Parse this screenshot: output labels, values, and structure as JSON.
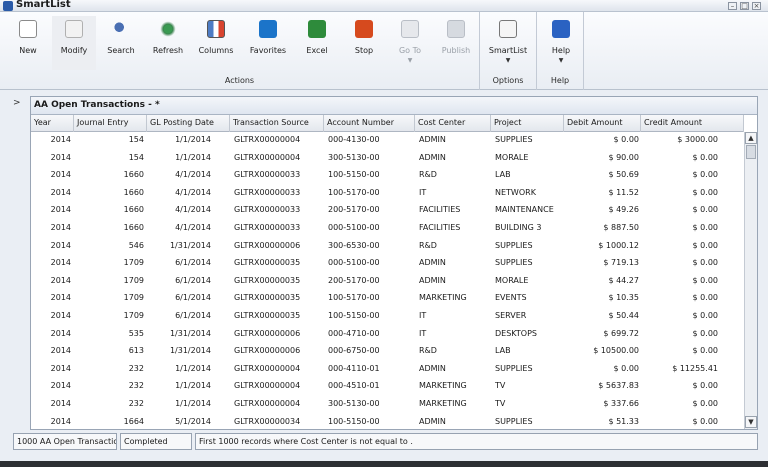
{
  "window": {
    "title": "SmartList"
  },
  "ribbon": {
    "buttons": {
      "new": "New",
      "modify": "Modify",
      "search": "Search",
      "refresh": "Refresh",
      "columns": "Columns",
      "favorites": "Favorites",
      "excel": "Excel",
      "stop": "Stop",
      "goto": "Go To",
      "publish": "Publish",
      "smartlist": "SmartList",
      "help": "Help"
    },
    "groups": {
      "actions": "Actions",
      "options": "Options",
      "help": "Help"
    }
  },
  "grid": {
    "title": "AA Open Transactions - *",
    "expander": ">",
    "columns": [
      "Year",
      "Journal Entry",
      "GL Posting Date",
      "Transaction Source",
      "Account Number",
      "Cost Center",
      "Project",
      "Debit Amount",
      "Credit Amount"
    ],
    "rows": [
      [
        "2014",
        "154",
        "1/1/2014",
        "GLTRX00000004",
        "000-4130-00",
        "ADMIN",
        "SUPPLIES",
        "$ 0.00",
        "$ 3000.00"
      ],
      [
        "2014",
        "154",
        "1/1/2014",
        "GLTRX00000004",
        "300-5130-00",
        "ADMIN",
        "MORALE",
        "$ 90.00",
        "$ 0.00"
      ],
      [
        "2014",
        "1660",
        "4/1/2014",
        "GLTRX00000033",
        "100-5150-00",
        "R&D",
        "LAB",
        "$ 50.69",
        "$ 0.00"
      ],
      [
        "2014",
        "1660",
        "4/1/2014",
        "GLTRX00000033",
        "100-5170-00",
        "IT",
        "NETWORK",
        "$ 11.52",
        "$ 0.00"
      ],
      [
        "2014",
        "1660",
        "4/1/2014",
        "GLTRX00000033",
        "200-5170-00",
        "FACILITIES",
        "MAINTENANCE",
        "$ 49.26",
        "$ 0.00"
      ],
      [
        "2014",
        "1660",
        "4/1/2014",
        "GLTRX00000033",
        "000-5100-00",
        "FACILITIES",
        "BUILDING 3",
        "$ 887.50",
        "$ 0.00"
      ],
      [
        "2014",
        "546",
        "1/31/2014",
        "GLTRX00000006",
        "300-6530-00",
        "R&D",
        "SUPPLIES",
        "$ 1000.12",
        "$ 0.00"
      ],
      [
        "2014",
        "1709",
        "6/1/2014",
        "GLTRX00000035",
        "000-5100-00",
        "ADMIN",
        "SUPPLIES",
        "$ 719.13",
        "$ 0.00"
      ],
      [
        "2014",
        "1709",
        "6/1/2014",
        "GLTRX00000035",
        "200-5170-00",
        "ADMIN",
        "MORALE",
        "$ 44.27",
        "$ 0.00"
      ],
      [
        "2014",
        "1709",
        "6/1/2014",
        "GLTRX00000035",
        "100-5170-00",
        "MARKETING",
        "EVENTS",
        "$ 10.35",
        "$ 0.00"
      ],
      [
        "2014",
        "1709",
        "6/1/2014",
        "GLTRX00000035",
        "100-5150-00",
        "IT",
        "SERVER",
        "$ 50.44",
        "$ 0.00"
      ],
      [
        "2014",
        "535",
        "1/31/2014",
        "GLTRX00000006",
        "000-4710-00",
        "IT",
        "DESKTOPS",
        "$ 699.72",
        "$ 0.00"
      ],
      [
        "2014",
        "613",
        "1/31/2014",
        "GLTRX00000006",
        "000-6750-00",
        "R&D",
        "LAB",
        "$ 10500.00",
        "$ 0.00"
      ],
      [
        "2014",
        "232",
        "1/1/2014",
        "GLTRX00000004",
        "000-4110-01",
        "ADMIN",
        "SUPPLIES",
        "$ 0.00",
        "$ 11255.41"
      ],
      [
        "2014",
        "232",
        "1/1/2014",
        "GLTRX00000004",
        "000-4510-01",
        "MARKETING",
        "TV",
        "$ 5637.83",
        "$ 0.00"
      ],
      [
        "2014",
        "232",
        "1/1/2014",
        "GLTRX00000004",
        "300-5130-00",
        "MARKETING",
        "TV",
        "$ 337.66",
        "$ 0.00"
      ],
      [
        "2014",
        "1664",
        "5/1/2014",
        "GLTRX00000034",
        "100-5150-00",
        "ADMIN",
        "SUPPLIES",
        "$ 51.33",
        "$ 0.00"
      ]
    ]
  },
  "status": {
    "records": "1000 AA Open Transactio",
    "state": "Completed",
    "message": "First 1000 records where Cost Center is not equal to ."
  },
  "colors": {
    "accent": "#2a5aa8",
    "ribbon_bg": "#e9edf3",
    "grid_border": "#99a5b5"
  }
}
